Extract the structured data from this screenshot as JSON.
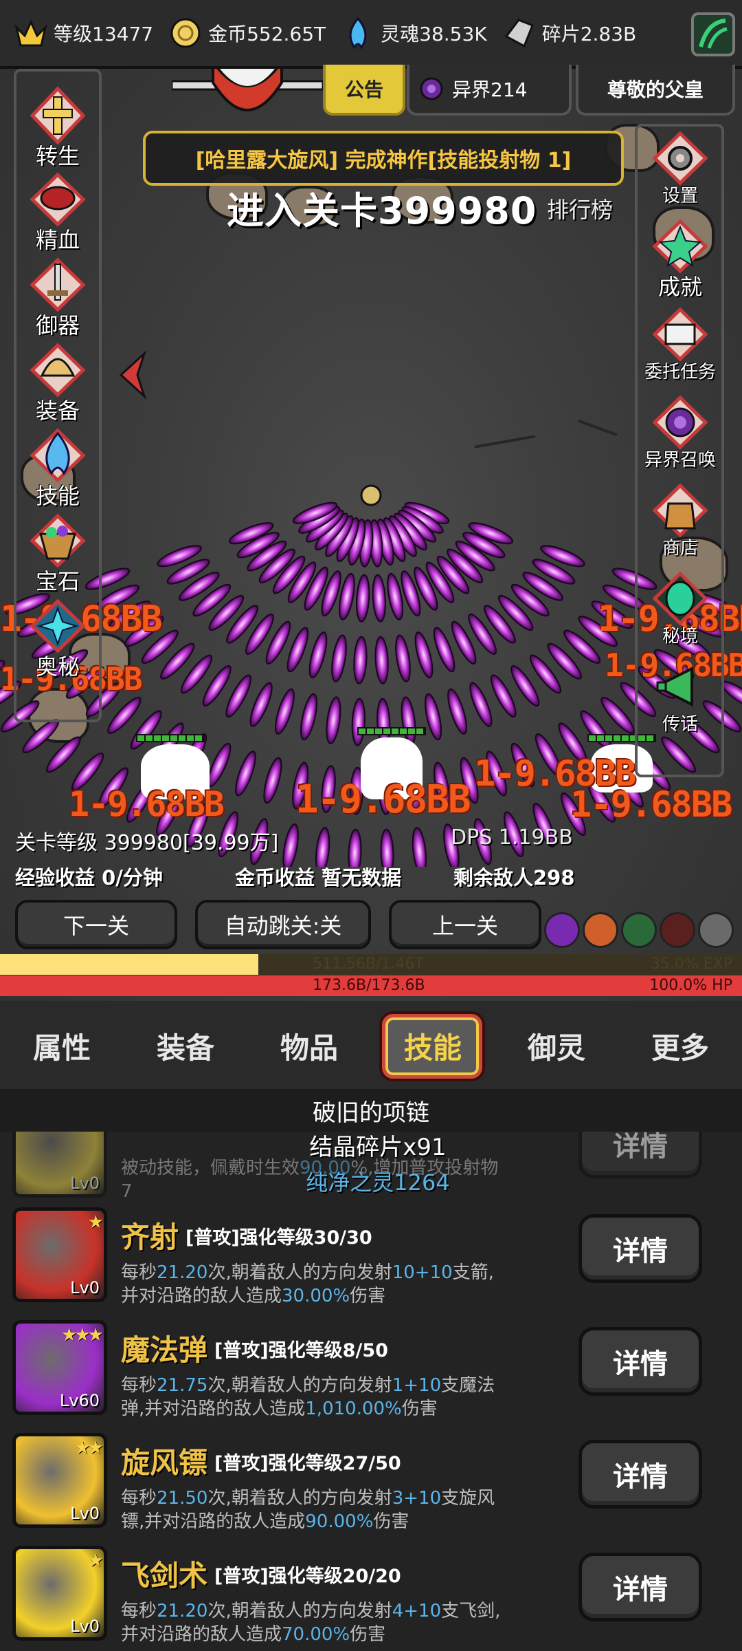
{
  "resources": {
    "level": "等级13477",
    "gold": "金币552.65T",
    "soul": "灵魂38.53K",
    "fragment": "碎片2.83B"
  },
  "top_tabs": {
    "notice": "公告",
    "otherworld": "异界214",
    "father": "尊敬的父皇"
  },
  "announcement": "[哈里露大旋风] 完成神作[技能投射物 1]",
  "stage_enter": "进入关卡399980",
  "rank": "排行榜",
  "left_menu": [
    "转生",
    "精血",
    "御器",
    "装备",
    "技能",
    "宝石",
    "奥秘"
  ],
  "right_menu": [
    "设置",
    "成就",
    "委托任务",
    "异界召唤",
    "商店",
    "秘境",
    "传话"
  ],
  "damage_numbers": [
    "1-9.68BB",
    "1-9.68BB",
    "1-9.68BB",
    "1-9.68BB",
    "1-9.68BB",
    "1-9.68BB",
    "1-9.68BB",
    "1-9.68BB"
  ],
  "stage_info": {
    "stage_level": "关卡等级 399980[39.99万]",
    "dps": "DPS 1.19BB",
    "exp_income": "经验收益 0/分钟",
    "gold_income": "金币收益 暂无数据",
    "enemies_left": "剩余敌人298"
  },
  "nav_buttons": {
    "next": "下一关",
    "auto": "自动跳关:关",
    "prev": "上一关"
  },
  "exp_bar": {
    "text": "511.56B/1.46T",
    "percent": "35.0% EXP",
    "fraction": 0.35
  },
  "hp_bar": {
    "text": "173.6B/173.6B",
    "percent": "100.0%   HP",
    "fraction": 1.0
  },
  "bottom_tabs": [
    "属性",
    "装备",
    "物品",
    "技能",
    "御灵",
    "更多"
  ],
  "item_title": "破旧的项链",
  "popover": {
    "line1": "结晶碎片x91",
    "line2": "纯净之灵1264"
  },
  "skills": [
    {
      "name": "",
      "tag": "",
      "desc_parts": [
        [
          "被动技能，佩戴时生效",
          ""
        ],
        [
          "90.00",
          "b"
        ],
        [
          "%,增加普攻投射物7",
          ""
        ]
      ],
      "level": "Lv0",
      "stars": "",
      "button": "详情",
      "color": "#e8d04a"
    },
    {
      "name": "齐射",
      "tag": "[普攻]强化等级30/30",
      "desc_parts": [
        [
          "每秒",
          ""
        ],
        [
          "21.20",
          "b"
        ],
        [
          "次,朝着敌人的方向发射",
          ""
        ],
        [
          "10+10",
          "b"
        ],
        [
          "支箭,并对沿路的敌人造成",
          ""
        ],
        [
          "30.00%",
          "b"
        ],
        [
          "伤害",
          ""
        ]
      ],
      "level": "Lv0",
      "stars": "★",
      "button": "详情",
      "color": "#c8322a"
    },
    {
      "name": "魔法弹",
      "tag": "[普攻]强化等级8/50",
      "desc_parts": [
        [
          "每秒",
          ""
        ],
        [
          "21.75",
          "b"
        ],
        [
          "次,朝着敌人的方向发射",
          ""
        ],
        [
          "1+10",
          "b"
        ],
        [
          "支魔法弹,并对沿路的敌人造成",
          ""
        ],
        [
          "1,010.00%",
          "b"
        ],
        [
          "伤害",
          ""
        ]
      ],
      "level": "Lv60",
      "stars": "★★★",
      "button": "详情",
      "color": "#9a2fc8"
    },
    {
      "name": "旋风镖",
      "tag": "[普攻]强化等级27/50",
      "desc_parts": [
        [
          "每秒",
          ""
        ],
        [
          "21.50",
          "b"
        ],
        [
          "次,朝着敌人的方向发射",
          ""
        ],
        [
          "3+10",
          "b"
        ],
        [
          "支旋风镖,并对沿路的敌人造成",
          ""
        ],
        [
          "90.00%",
          "b"
        ],
        [
          "伤害",
          ""
        ]
      ],
      "level": "Lv0",
      "stars": "★★",
      "button": "详情",
      "color": "#f0c030"
    },
    {
      "name": "飞剑术",
      "tag": "[普攻]强化等级20/20",
      "desc_parts": [
        [
          "每秒",
          ""
        ],
        [
          "21.20",
          "b"
        ],
        [
          "次,朝着敌人的方向发射",
          ""
        ],
        [
          "4+10",
          "b"
        ],
        [
          "支飞剑,并对沿路的敌人造成",
          ""
        ],
        [
          "70.00%",
          "b"
        ],
        [
          "伤害",
          ""
        ]
      ],
      "level": "Lv0",
      "stars": "★",
      "button": "详情",
      "color": "#f2d02a"
    }
  ]
}
